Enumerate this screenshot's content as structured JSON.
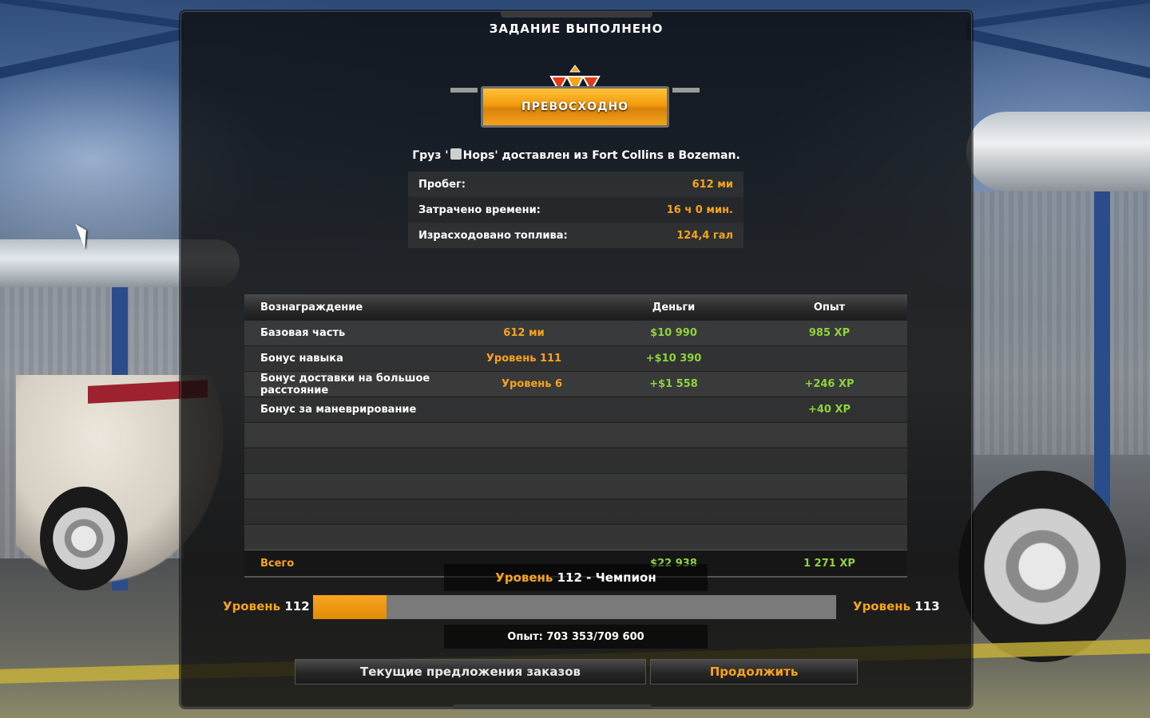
{
  "window": {
    "title": "ЗАДАНИЕ ВЫПОЛНЕНО"
  },
  "rating": {
    "label": "ПРЕВОСХОДНО"
  },
  "cargo": {
    "prefix": "Груз '",
    "name": "Hops",
    "suffix": "' доставлен из Fort Collins в Bozeman.",
    "icon": "barrel-icon"
  },
  "stats": [
    {
      "label": "Пробег:",
      "value": "612 ми"
    },
    {
      "label": "Затрачено времени:",
      "value": "16 ч 0 мин."
    },
    {
      "label": "Израсходовано топлива:",
      "value": "124,4 гал"
    }
  ],
  "rewards": {
    "headers": {
      "reward": "Вознаграждение",
      "money": "Деньги",
      "xp": "Опыт"
    },
    "rows": [
      {
        "name": "Базовая часть",
        "detail": "612 ми",
        "money": "$10 990",
        "xp": "985 XP"
      },
      {
        "name": "Бонус навыка",
        "detail": "Уровень 111",
        "money": "+$10 390",
        "xp": ""
      },
      {
        "name": "Бонус доставки на большое расстояние",
        "detail": "Уровень 6",
        "money": "+$1 558",
        "xp": "+246 XP"
      },
      {
        "name": "Бонус за маневрирование",
        "detail": "",
        "money": "",
        "xp": "+40 XP"
      }
    ],
    "total": {
      "label": "Всего",
      "money": "$22 938",
      "xp": "1 271 XP"
    }
  },
  "level": {
    "title_prefix": "Уровень",
    "title_value": "112 - Чемпион",
    "left_label": "Уровень",
    "left_value": "112",
    "right_label": "Уровень",
    "right_value": "113",
    "progress_percent": 14,
    "xp_text": "Опыт: 703 353/709 600"
  },
  "buttons": {
    "offers": "Текущие предложения заказов",
    "continue": "Продолжить"
  },
  "colors": {
    "accent": "#f6a419",
    "positive": "#8fd339"
  }
}
